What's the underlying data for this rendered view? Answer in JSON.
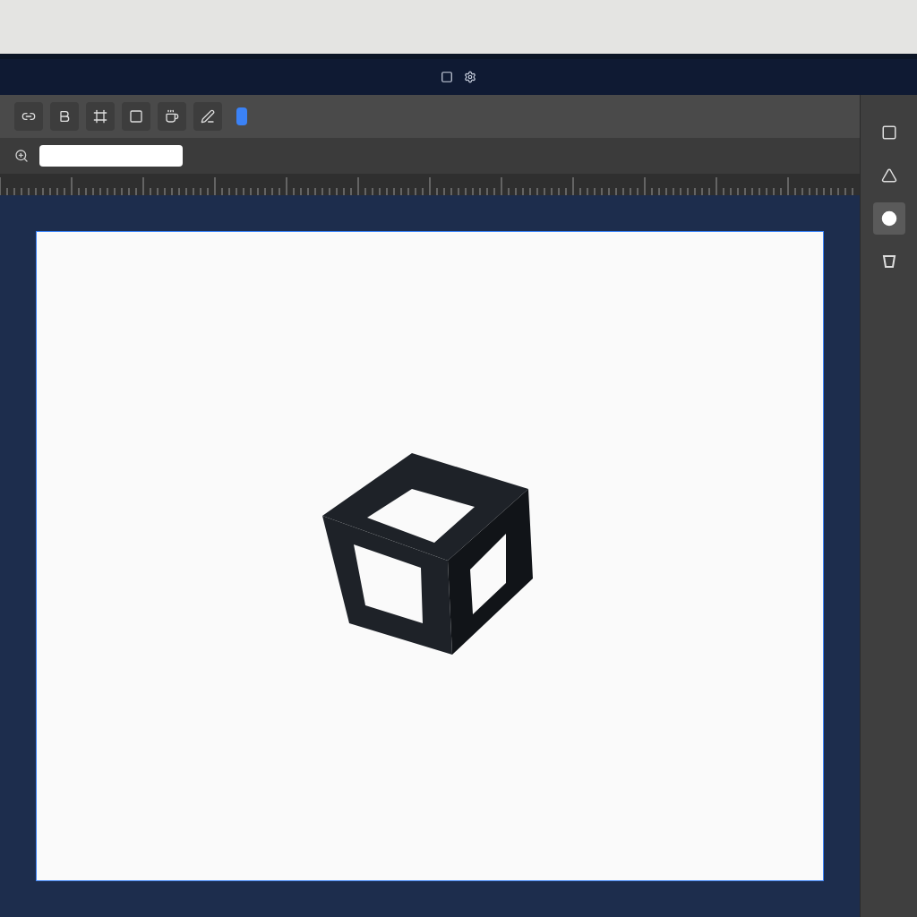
{
  "toolbar": {
    "buttons": [
      {
        "kind": "link",
        "selected": false
      },
      {
        "kind": "bold",
        "selected": false
      },
      {
        "kind": "frame",
        "selected": false
      },
      {
        "kind": "square",
        "selected": false
      },
      {
        "kind": "cup",
        "selected": false
      },
      {
        "kind": "pen",
        "selected": false
      },
      {
        "kind": "dot",
        "selected": true
      }
    ]
  },
  "tools_panel": {
    "tools": [
      {
        "kind": "square",
        "selected": false
      },
      {
        "kind": "triangle",
        "selected": false
      },
      {
        "kind": "circle",
        "selected": true
      },
      {
        "kind": "trapezoid",
        "selected": false
      }
    ]
  },
  "artboard": {
    "kind": "cube"
  }
}
